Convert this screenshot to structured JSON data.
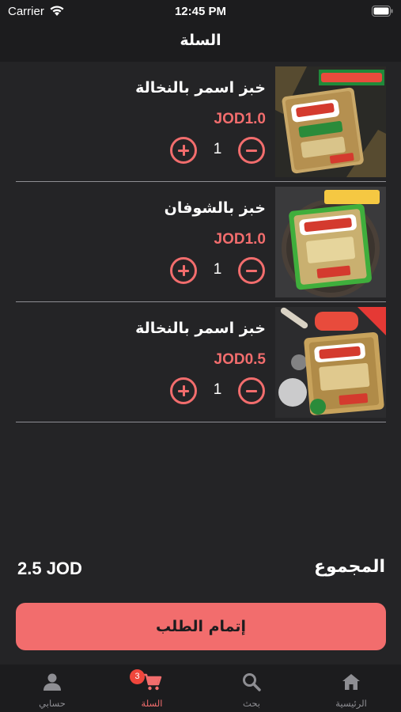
{
  "status_bar": {
    "carrier": "Carrier",
    "time": "12:45 PM"
  },
  "header": {
    "title": "السلة"
  },
  "cart": {
    "items": [
      {
        "name": "خبز اسمر بالنخالة",
        "price": "JOD1.0",
        "quantity": "1",
        "image_icon": "bread-bran-package-image"
      },
      {
        "name": "خبز بالشوفان",
        "price": "JOD1.0",
        "quantity": "1",
        "image_icon": "bread-oat-package-image"
      },
      {
        "name": "خبز اسمر بالنخالة",
        "price": "JOD0.5",
        "quantity": "1",
        "image_icon": "bread-bran-new-package-image"
      }
    ],
    "total_label": "المجموع",
    "total_value": "2.5 JOD",
    "checkout_label": "إتمام الطلب"
  },
  "tab_bar": {
    "tabs": [
      {
        "label": "الرئيسية",
        "icon": "home-icon",
        "active": false
      },
      {
        "label": "بحث",
        "icon": "search-icon",
        "active": false
      },
      {
        "label": "السلة",
        "icon": "cart-icon",
        "active": true,
        "badge": "3"
      },
      {
        "label": "حسابي",
        "icon": "person-icon",
        "active": false
      }
    ]
  },
  "colors": {
    "accent": "#f26d6d",
    "background": "#242426",
    "bar_background": "#1c1c1e",
    "badge": "#f0463c"
  }
}
